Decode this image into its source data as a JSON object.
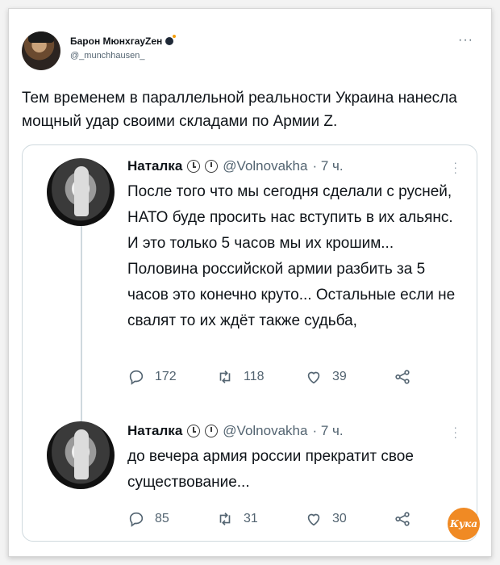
{
  "outer_tweet": {
    "author_name": "Барон МюнхгауZен",
    "handle": "@_munchhausen_",
    "text": "Тем временем в параллельной реальности Украина нанесла мощный удар своими складами по Армии Z."
  },
  "quoted_thread": [
    {
      "author_name": "Наталка",
      "handle": "@Volnovakha",
      "time": "· 7 ч.",
      "text": "После того что мы сегодня сделали с русней, НАТО буде просить нас вступить в их альянс. И это только 5 часов мы их крошим... Половина российской армии разбить за 5 часов это конечно круто... Остальные если не свалят то их ждёт также судьба,",
      "replies": "172",
      "retweets": "118",
      "likes": "39"
    },
    {
      "author_name": "Наталка",
      "handle": "@Volnovakha",
      "time": "· 7 ч.",
      "text": "до вечера армия россии прекратит свое существование...",
      "replies": "85",
      "retweets": "31",
      "likes": "30"
    }
  ],
  "watermark": "Кука",
  "icons": {
    "reply": "reply-icon",
    "retweet": "retweet-icon",
    "like": "heart-icon",
    "share": "share-icon",
    "clock": "clock-icon",
    "more": "more-icon"
  }
}
